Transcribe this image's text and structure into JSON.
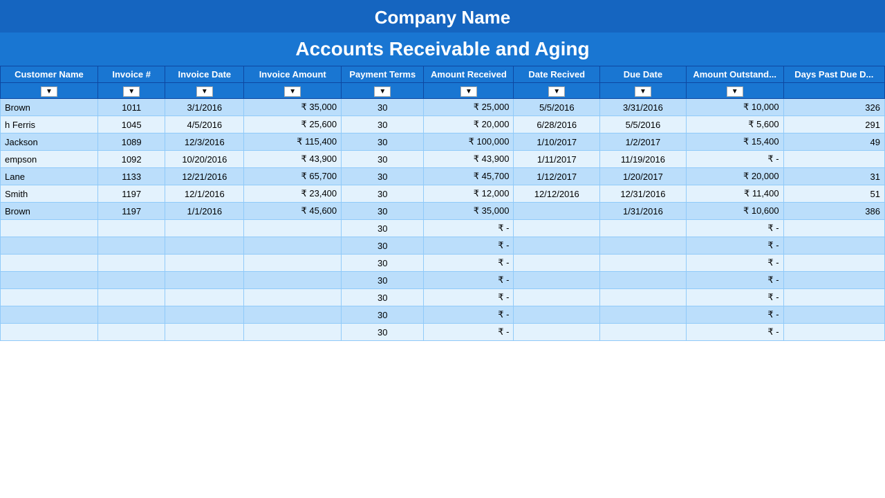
{
  "header": {
    "company_name": "Company Name",
    "report_title": "Accounts Receivable and Aging"
  },
  "columns": [
    {
      "id": "customer",
      "label": "Customer Name"
    },
    {
      "id": "invoice_num",
      "label": "Invoice #"
    },
    {
      "id": "invoice_date",
      "label": "Invoice Date"
    },
    {
      "id": "invoice_amount",
      "label": "Invoice Amount"
    },
    {
      "id": "payment_terms",
      "label": "Payment Terms"
    },
    {
      "id": "amount_received",
      "label": "Amount Received"
    },
    {
      "id": "date_received",
      "label": "Date Recived"
    },
    {
      "id": "due_date",
      "label": "Due Date"
    },
    {
      "id": "amount_outstanding",
      "label": "Amount Outstand..."
    },
    {
      "id": "days_past_due",
      "label": "Days Past Due D..."
    }
  ],
  "rows": [
    {
      "customer": "Brown",
      "invoice_num": "1011",
      "invoice_date": "3/1/2016",
      "invoice_amount": "₹   35,000",
      "payment_terms": "30",
      "amount_received": "₹   25,000",
      "date_received": "5/5/2016",
      "due_date": "3/31/2016",
      "amount_outstanding": "₹   10,000",
      "days_past_due": "326"
    },
    {
      "customer": "h Ferris",
      "invoice_num": "1045",
      "invoice_date": "4/5/2016",
      "invoice_amount": "₹   25,600",
      "payment_terms": "30",
      "amount_received": "₹   20,000",
      "date_received": "6/28/2016",
      "due_date": "5/5/2016",
      "amount_outstanding": "₹    5,600",
      "days_past_due": "291"
    },
    {
      "customer": "Jackson",
      "invoice_num": "1089",
      "invoice_date": "12/3/2016",
      "invoice_amount": "₹ 115,400",
      "payment_terms": "30",
      "amount_received": "₹ 100,000",
      "date_received": "1/10/2017",
      "due_date": "1/2/2017",
      "amount_outstanding": "₹   15,400",
      "days_past_due": "49"
    },
    {
      "customer": "empson",
      "invoice_num": "1092",
      "invoice_date": "10/20/2016",
      "invoice_amount": "₹   43,900",
      "payment_terms": "30",
      "amount_received": "₹   43,900",
      "date_received": "1/11/2017",
      "due_date": "11/19/2016",
      "amount_outstanding": "₹        -",
      "days_past_due": ""
    },
    {
      "customer": "Lane",
      "invoice_num": "1133",
      "invoice_date": "12/21/2016",
      "invoice_amount": "₹   65,700",
      "payment_terms": "30",
      "amount_received": "₹   45,700",
      "date_received": "1/12/2017",
      "due_date": "1/20/2017",
      "amount_outstanding": "₹   20,000",
      "days_past_due": "31"
    },
    {
      "customer": "Smith",
      "invoice_num": "1197",
      "invoice_date": "12/1/2016",
      "invoice_amount": "₹   23,400",
      "payment_terms": "30",
      "amount_received": "₹   12,000",
      "date_received": "12/12/2016",
      "due_date": "12/31/2016",
      "amount_outstanding": "₹   11,400",
      "days_past_due": "51"
    },
    {
      "customer": "Brown",
      "invoice_num": "1197",
      "invoice_date": "1/1/2016",
      "invoice_amount": "₹   45,600",
      "payment_terms": "30",
      "amount_received": "₹   35,000",
      "date_received": "",
      "due_date": "1/31/2016",
      "amount_outstanding": "₹   10,600",
      "days_past_due": "386"
    },
    {
      "customer": "",
      "invoice_num": "",
      "invoice_date": "",
      "invoice_amount": "",
      "payment_terms": "30",
      "amount_received": "₹        -",
      "date_received": "",
      "due_date": "",
      "amount_outstanding": "₹        -",
      "days_past_due": ""
    },
    {
      "customer": "",
      "invoice_num": "",
      "invoice_date": "",
      "invoice_amount": "",
      "payment_terms": "30",
      "amount_received": "₹        -",
      "date_received": "",
      "due_date": "",
      "amount_outstanding": "₹        -",
      "days_past_due": ""
    },
    {
      "customer": "",
      "invoice_num": "",
      "invoice_date": "",
      "invoice_amount": "",
      "payment_terms": "30",
      "amount_received": "₹        -",
      "date_received": "",
      "due_date": "",
      "amount_outstanding": "₹        -",
      "days_past_due": ""
    },
    {
      "customer": "",
      "invoice_num": "",
      "invoice_date": "",
      "invoice_amount": "",
      "payment_terms": "30",
      "amount_received": "₹        -",
      "date_received": "",
      "due_date": "",
      "amount_outstanding": "₹        -",
      "days_past_due": ""
    },
    {
      "customer": "",
      "invoice_num": "",
      "invoice_date": "",
      "invoice_amount": "",
      "payment_terms": "30",
      "amount_received": "₹        -",
      "date_received": "",
      "due_date": "",
      "amount_outstanding": "₹        -",
      "days_past_due": ""
    },
    {
      "customer": "",
      "invoice_num": "",
      "invoice_date": "",
      "invoice_amount": "",
      "payment_terms": "30",
      "amount_received": "₹        -",
      "date_received": "",
      "due_date": "",
      "amount_outstanding": "₹        -",
      "days_past_due": ""
    },
    {
      "customer": "",
      "invoice_num": "",
      "invoice_date": "",
      "invoice_amount": "",
      "payment_terms": "30",
      "amount_received": "₹        -",
      "date_received": "",
      "due_date": "",
      "amount_outstanding": "₹        -",
      "days_past_due": ""
    }
  ]
}
